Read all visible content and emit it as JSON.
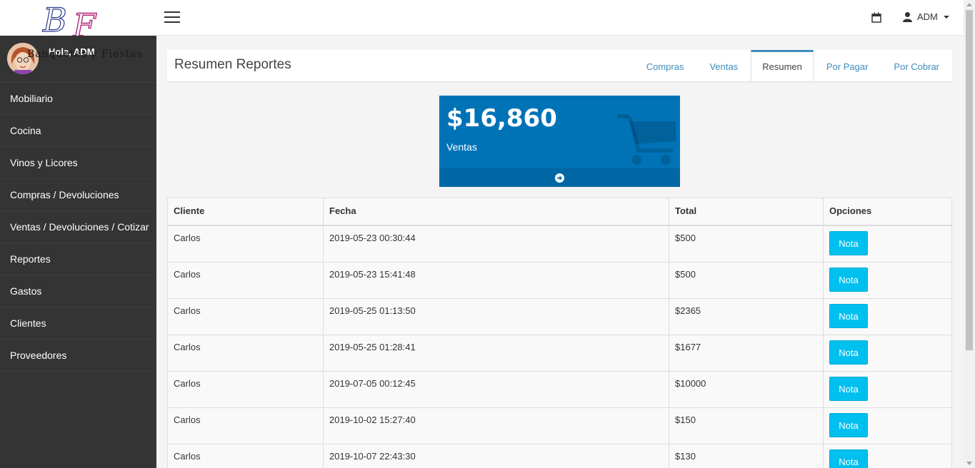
{
  "header": {
    "logo_monogram": "BF",
    "user_name": "ADM"
  },
  "sidebar": {
    "greeting": "Hola, ADM",
    "logo_text": "Banquetes y Fiestas",
    "items": [
      {
        "label": "Mobiliario"
      },
      {
        "label": "Cocina"
      },
      {
        "label": "Vinos y Licores"
      },
      {
        "label": "Compras / Devoluciones"
      },
      {
        "label": "Ventas / Devoluciones / Cotizar"
      },
      {
        "label": "Reportes"
      },
      {
        "label": "Gastos"
      },
      {
        "label": "Clientes"
      },
      {
        "label": "Proveedores"
      }
    ]
  },
  "main": {
    "title": "Resumen Reportes",
    "tabs": [
      {
        "label": "Compras"
      },
      {
        "label": "Ventas"
      },
      {
        "label": "Resumen",
        "active": true
      },
      {
        "label": "Por Pagar"
      },
      {
        "label": "Por Cobrar"
      }
    ],
    "stat": {
      "value": "$16,860",
      "label": "Ventas",
      "icon": "shopping-cart-icon"
    },
    "table": {
      "headers": [
        "Cliente",
        "Fecha",
        "Total",
        "Opciones"
      ],
      "button_label": "Nota",
      "rows": [
        {
          "cliente": "Carlos",
          "fecha": "2019-05-23 00:30:44",
          "total": "$500"
        },
        {
          "cliente": "Carlos",
          "fecha": "2019-05-23 15:41:48",
          "total": "$500"
        },
        {
          "cliente": "Carlos",
          "fecha": "2019-05-25 01:13:50",
          "total": "$2365"
        },
        {
          "cliente": "Carlos",
          "fecha": "2019-05-25 01:28:41",
          "total": "$1677"
        },
        {
          "cliente": "Carlos",
          "fecha": "2019-07-05 00:12:45",
          "total": "$10000"
        },
        {
          "cliente": "Carlos",
          "fecha": "2019-10-02 15:27:40",
          "total": "$150"
        },
        {
          "cliente": "Carlos",
          "fecha": "2019-10-07 22:43:30",
          "total": "$130"
        }
      ]
    }
  },
  "colors": {
    "sidebar_bg": "#343434",
    "stat_bg": "#0073b7",
    "button_bg": "#00c0ef",
    "tab_active_border": "#3c8dbc"
  }
}
